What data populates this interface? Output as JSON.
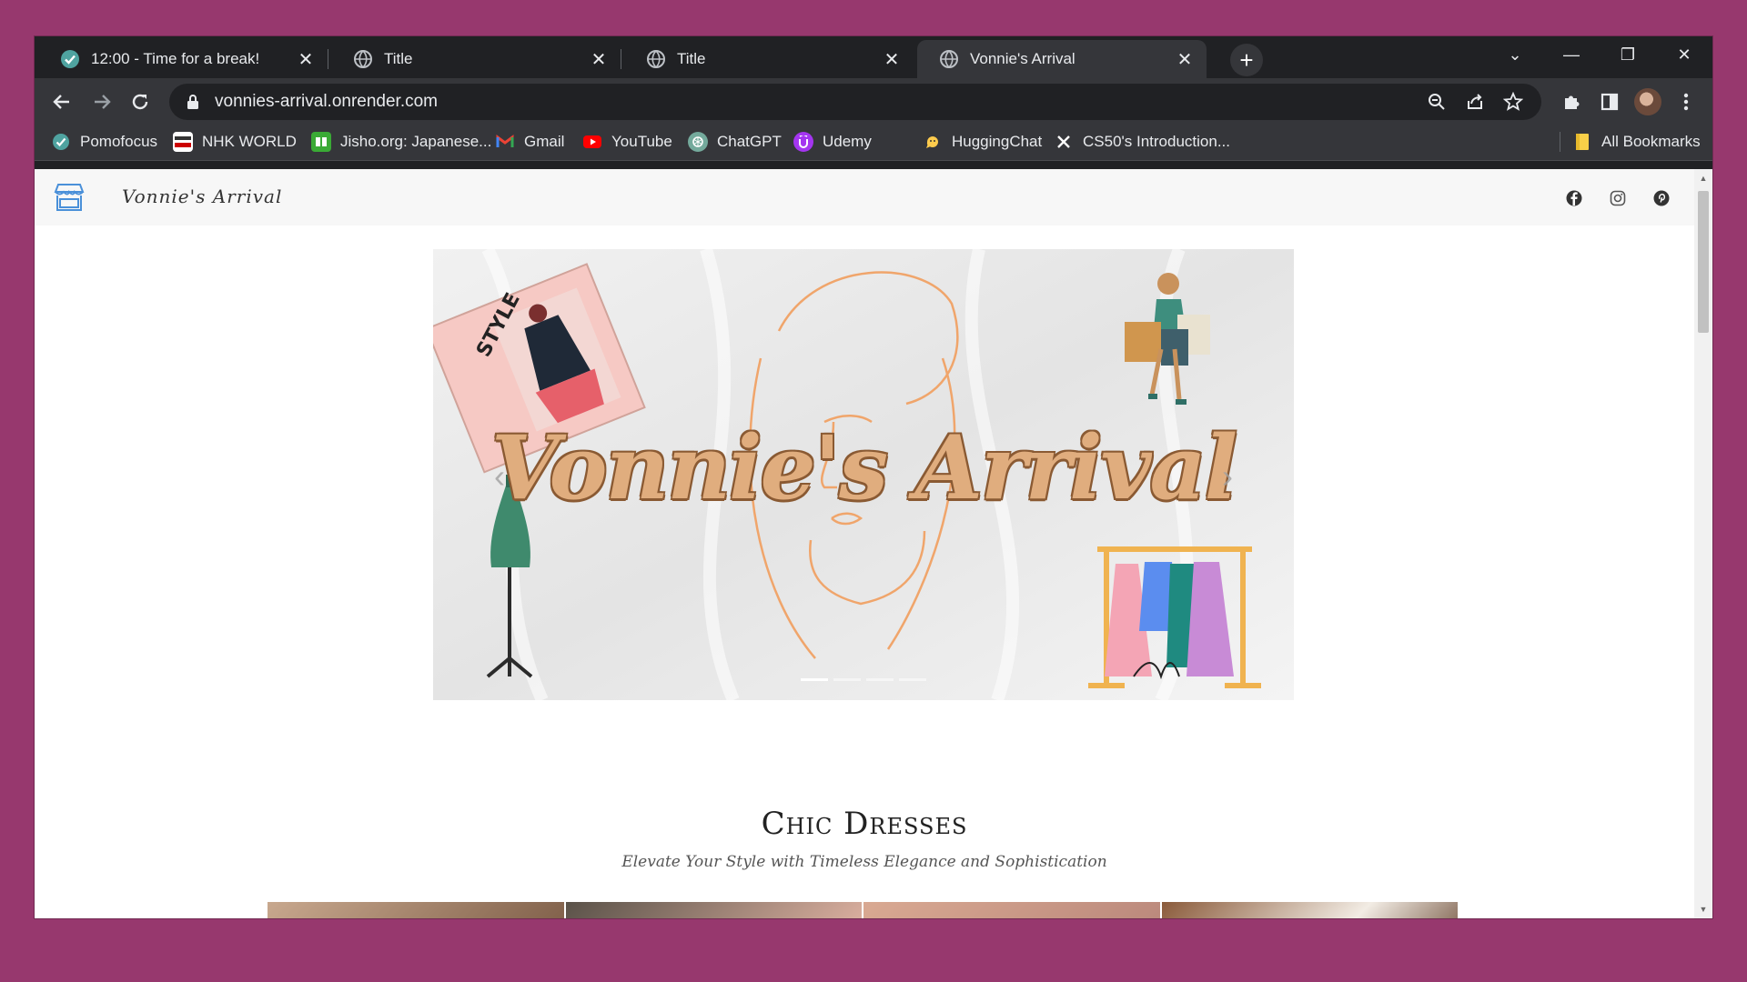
{
  "browser": {
    "tabs": [
      {
        "title": "12:00 - Time for a break!",
        "icon": "pomodoro-check-icon",
        "active": false
      },
      {
        "title": "Title",
        "icon": "globe-icon",
        "active": false
      },
      {
        "title": "Title",
        "icon": "globe-icon",
        "active": false
      },
      {
        "title": "Vonnie's Arrival",
        "icon": "globe-icon",
        "active": true
      }
    ],
    "tab_close_glyph": "✕",
    "new_tab_glyph": "+",
    "window_controls": {
      "tab_search": "⌄",
      "minimize": "—",
      "restore": "❐",
      "close": "✕"
    },
    "address_bar": {
      "url": "vonnies-arrival.onrender.com"
    },
    "bookmarks": [
      {
        "label": "Pomofocus",
        "icon": "pomofocus-icon",
        "color": "#4fa3a0"
      },
      {
        "label": "NHK WORLD",
        "icon": "nhk-icon",
        "color": "#ffffff"
      },
      {
        "label": "Jisho.org: Japanese...",
        "icon": "jisho-icon",
        "color": "#3aaa35"
      },
      {
        "label": "Gmail",
        "icon": "gmail-icon",
        "color": "#ea4335"
      },
      {
        "label": "YouTube",
        "icon": "youtube-icon",
        "color": "#ff0000"
      },
      {
        "label": "ChatGPT",
        "icon": "chatgpt-icon",
        "color": "#74aa9c"
      },
      {
        "label": "Udemy",
        "icon": "udemy-icon",
        "color": "#a435f0"
      },
      {
        "label": "HuggingChat",
        "icon": "huggingchat-icon",
        "color": "#ffcc4d"
      },
      {
        "label": "CS50's Introduction...",
        "icon": "x-icon",
        "color": "#ffffff"
      }
    ],
    "all_bookmarks_label": "All Bookmarks"
  },
  "site": {
    "brand_name": "Vonnie's Arrival",
    "hero_text": "Vonnie's Arrival",
    "hero_magazine_text": "STYLE",
    "carousel": {
      "prev": "‹",
      "next": "›",
      "slides": 4,
      "active_slide": 1
    },
    "section": {
      "title": "Chic Dresses",
      "subtitle": "Elevate Your Style with Timeless Elegance and Sophistication"
    }
  },
  "colors": {
    "desktop_bg": "#97386e",
    "chrome_dark": "#202124",
    "chrome_toolbar": "#35363a",
    "hero_script": "#e0ad7e",
    "hero_line_art": "#f0a56b",
    "brand_icon": "#4a90d9"
  }
}
